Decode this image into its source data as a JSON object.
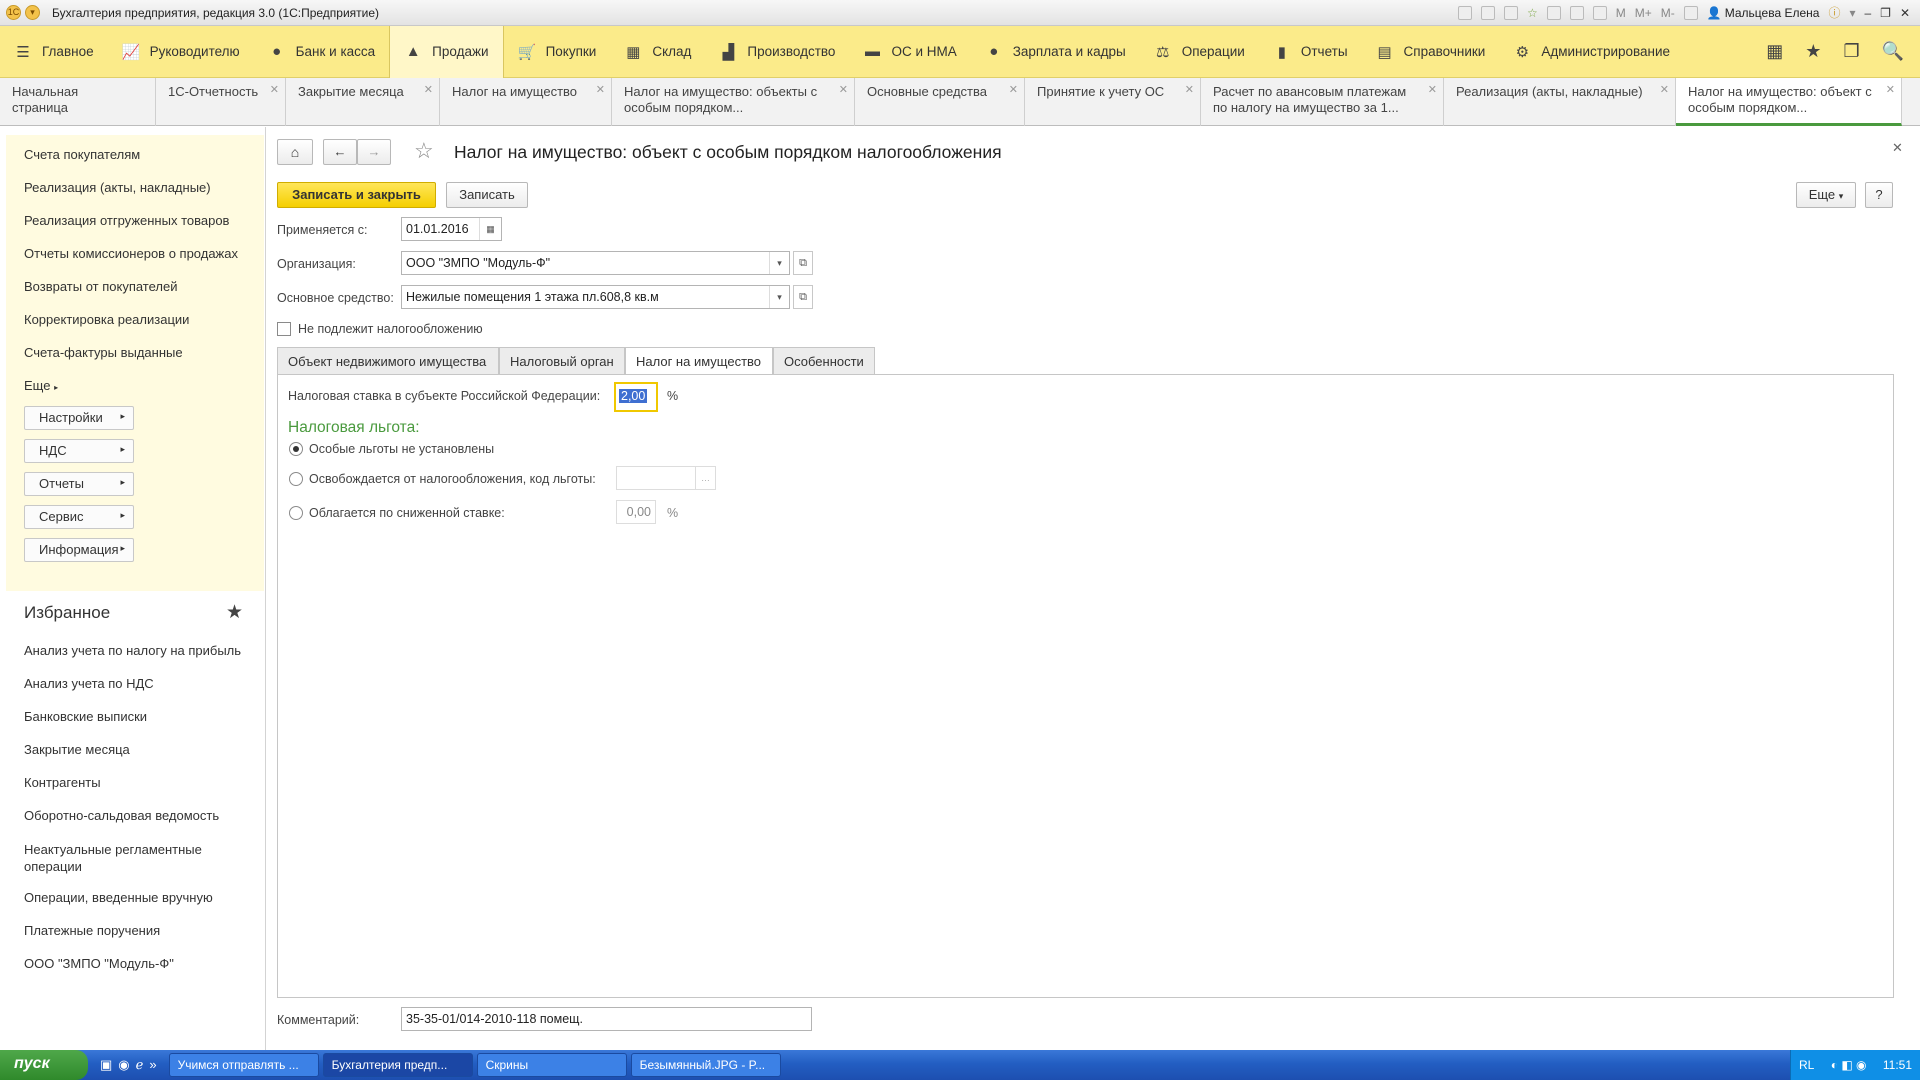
{
  "window": {
    "title": "Бухгалтерия предприятия, редакция 3.0  (1С:Предприятие)",
    "user": "Мальцева Елена",
    "window_controls": [
      "M",
      "M+",
      "M-"
    ]
  },
  "sections": [
    {
      "label": "Главное",
      "icon": "menu-icon"
    },
    {
      "label": "Руководителю",
      "icon": "chart-line-icon"
    },
    {
      "label": "Банк и касса",
      "icon": "coin-icon"
    },
    {
      "label": "Продажи",
      "icon": "bag-icon",
      "active": true
    },
    {
      "label": "Покупки",
      "icon": "cart-icon"
    },
    {
      "label": "Склад",
      "icon": "grid-icon"
    },
    {
      "label": "Производство",
      "icon": "factory-icon"
    },
    {
      "label": "ОС и НМА",
      "icon": "truck-icon"
    },
    {
      "label": "Зарплата и кадры",
      "icon": "person-icon"
    },
    {
      "label": "Операции",
      "icon": "scales-icon"
    },
    {
      "label": "Отчеты",
      "icon": "bar-chart-icon"
    },
    {
      "label": "Справочники",
      "icon": "book-icon"
    },
    {
      "label": "Администрирование",
      "icon": "gear-icon"
    }
  ],
  "open_tabs": [
    {
      "label": "Начальная страница"
    },
    {
      "label": "1С-Отчетность"
    },
    {
      "label": "Закрытие месяца"
    },
    {
      "label": "Налог на имущество"
    },
    {
      "label": "Налог на имущество: объекты с особым порядком..."
    },
    {
      "label": "Основные средства"
    },
    {
      "label": "Принятие к учету ОС"
    },
    {
      "label": "Расчет по авансовым платежам по налогу на имущество за 1..."
    },
    {
      "label": "Реализация (акты, накладные)"
    },
    {
      "label": "Налог на имущество: объект с особым порядком...",
      "active": true
    }
  ],
  "left_panel": {
    "links": [
      "Счета покупателям",
      "Реализация (акты, накладные)",
      "Реализация отгруженных товаров",
      "Отчеты комиссионеров о продажах",
      "Возвраты от покупателей",
      "Корректировка реализации",
      "Счета-фактуры выданные",
      "Еще"
    ],
    "buttons": [
      "Настройки",
      "НДС",
      "Отчеты",
      "Сервис",
      "Информация"
    ],
    "favorites_title": "Избранное",
    "favorites": [
      "Анализ учета по налогу на прибыль",
      "Анализ учета по НДС",
      "Банковские выписки",
      "Закрытие месяца",
      "Контрагенты",
      "Оборотно-сальдовая ведомость",
      "Неактуальные регламентные операции",
      "Операции, введенные вручную",
      "Платежные поручения",
      "ООО \"ЗМПО \"Модуль-Ф\""
    ]
  },
  "form": {
    "title": "Налог на имущество: объект с особым порядком налогообложения",
    "save_close_label": "Записать и закрыть",
    "save_label": "Записать",
    "more_label": "Еще",
    "help_label": "?",
    "applies_from_label": "Применяется с:",
    "applies_from_value": "01.01.2016",
    "organization_label": "Организация:",
    "organization_value": "ООО \"ЗМПО \"Модуль-Ф\"",
    "asset_label": "Основное средство:",
    "asset_value": "Нежилые помещения 1 этажа пл.608,8 кв.м",
    "not_taxable_label": "Не подлежит налогообложению",
    "not_taxable_checked": false,
    "tabs": [
      {
        "label": "Объект недвижимого имущества"
      },
      {
        "label": "Налоговый орган"
      },
      {
        "label": "Налог на имущество",
        "active": true
      },
      {
        "label": "Особенности"
      }
    ],
    "rate_label": "Налоговая ставка в субъекте Российской Федерации:",
    "rate_value": "2,00",
    "percent_sign": "%",
    "benefit_title": "Налоговая льгота:",
    "benefit_options": [
      {
        "label": "Особые льготы не установлены",
        "selected": true
      },
      {
        "label": "Освобождается от налогообложения, код льготы:",
        "selected": false
      },
      {
        "label": "Облагается по сниженной ставке:",
        "selected": false
      }
    ],
    "benefit_code_value": "",
    "reduced_rate_value": "0,00",
    "comment_label": "Комментарий:",
    "comment_value": "35-35-01/014-2010-118 помещ."
  },
  "taskbar": {
    "start_label": "пуск",
    "tasks": [
      {
        "label": "Учимся отправлять ..."
      },
      {
        "label": "Бухгалтерия предп...",
        "active": true
      },
      {
        "label": "Скрины"
      },
      {
        "label": "Безымянный.JPG - P..."
      }
    ],
    "lang": "RL",
    "time": "11:51"
  },
  "colors": {
    "section_bar": "#fbeb8a",
    "primary_button": "#f5cf00",
    "benefit_title": "#4a9a3e",
    "active_tab_border": "#4a9a3e"
  }
}
